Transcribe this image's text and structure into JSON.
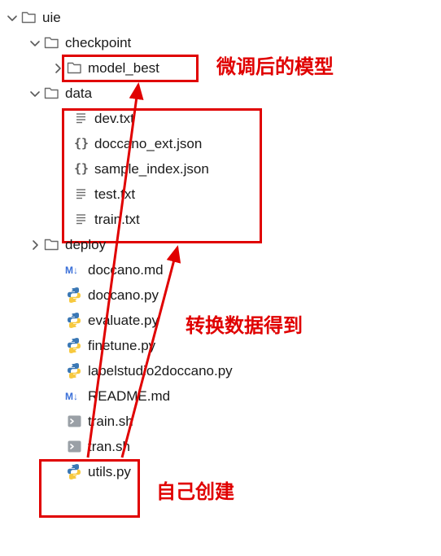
{
  "tree": {
    "root": {
      "name": "uie",
      "children": {
        "checkpoint": {
          "name": "checkpoint",
          "children": {
            "model_best": "model_best"
          }
        },
        "data": {
          "name": "data",
          "children": {
            "dev": "dev.txt",
            "doccano_ext": "doccano_ext.json",
            "sample_index": "sample_index.json",
            "test": "test.txt",
            "train": "train.txt"
          }
        },
        "deploy": "deploy",
        "files": {
          "doccano_md": "doccano.md",
          "doccano_py": "doccano.py",
          "evaluate_py": "evaluate.py",
          "finetune_py": "finetune.py",
          "labelstudio_py": "labelstudio2doccano.py",
          "readme_md": "README.md",
          "train_sh": "train.sh",
          "tran_sh": "tran.sh",
          "utils_py": "utils.py"
        }
      }
    }
  },
  "annotations": {
    "model_best_label": "微调后的模型",
    "data_files_label": "转换数据得到",
    "sh_files_label": "自己创建"
  }
}
